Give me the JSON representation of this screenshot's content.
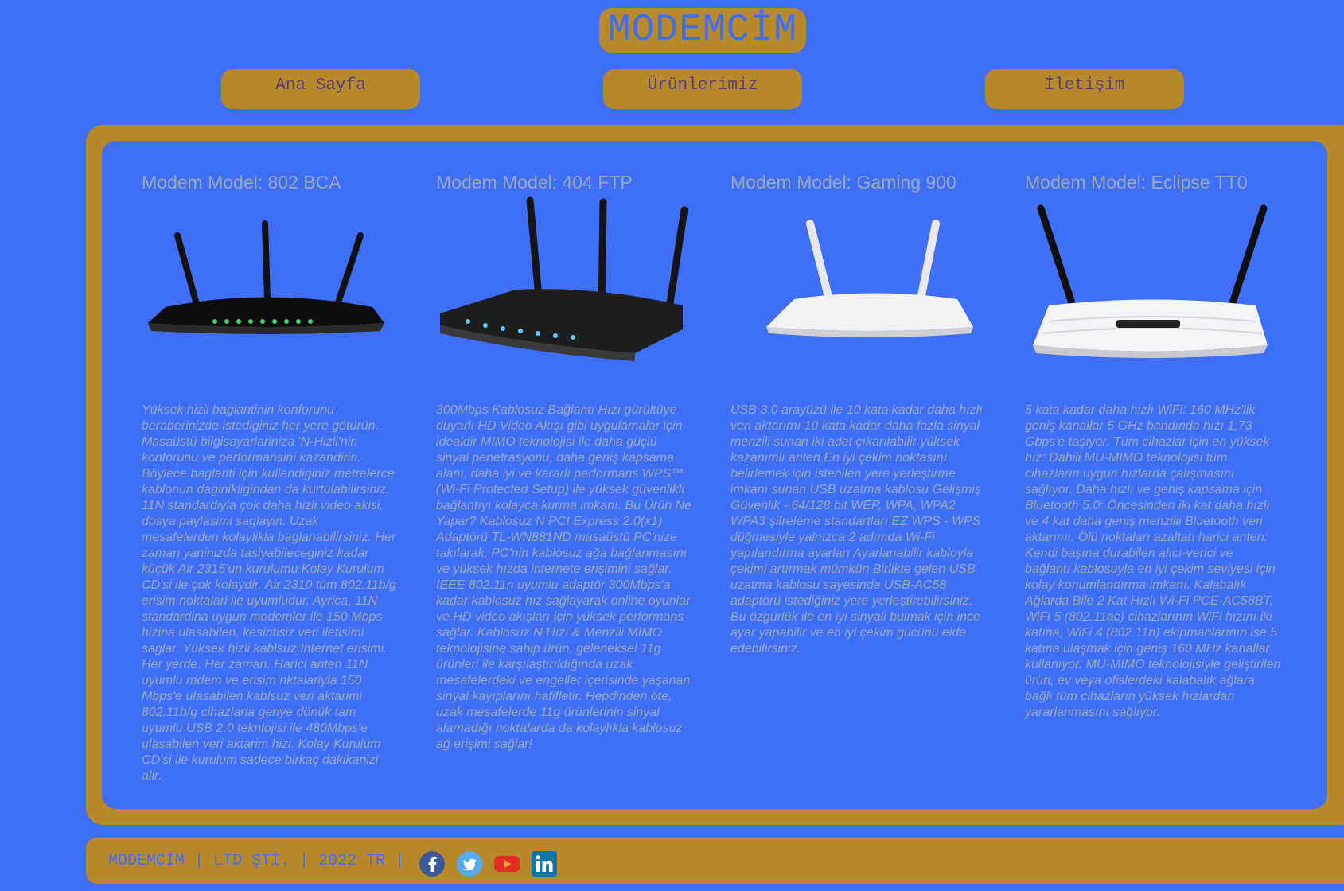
{
  "brand": {
    "logo_text": "MODEMCİM"
  },
  "nav": {
    "items": [
      {
        "label": "Ana Sayfa"
      },
      {
        "label": "Ürünlerimiz"
      },
      {
        "label": "İletişim"
      }
    ]
  },
  "products": [
    {
      "title": "Modem Model: 802 BCA",
      "description": "Yüksek hizli baglantinin konforunu beraberinizde istediginiz her yere götürün. Masaüstü bilgisayarlariniza 'N-Hizli'nin konforunu ve performansini kazandirin. Böylece baglanti için kullandiginiz metrelerce kablonun daginikligindan da kurtulabilirsiniz. 11N standardiyla çok daha hizli video akisi, dosya paylasimi saglayin. Uzak mesafelerden kolaylikla baglanabilirsiniz. Her zaman yaninizda tasiyabileceginiz kadar küçük Air 2315'un kurulumu Kolay Kurulum CD'si ile çok kolaydir. Air 2310 tüm 802.11b/g erisim noktalari ile uyumludur. Ayrica, 11N standardina uygun modemler ile 150 Mbps hizina ulasabilen, kesintisiz veri iletisimi saglar. Yüksek hizli kablsuz Internet erisimi. Her yerde. Her zaman. Harici anten 11N uyumlu mdem ve erisim nktalariyla 150 Mbps'e ulasabilen kablsuz veri aktarimi 802.11b/g cihazlarla geriye dönük tam uyumlu USB 2.0 teknlojisi ile 480Mbps'e ulasabilen veri aktarim hizi. Kolay Kurulum CD'si ile kurulum sadece birkaç dakikanizi alir."
    },
    {
      "title": "Modem Model: 404 FTP",
      "description": "300Mbps Kablosuz Bağlantı Hızı gürültüye duyarlı HD Video Akışı gibi uygulamalar için idealdir MIMO teknolojisi ile daha güçlü sinyal penetrasyonu, daha geniş kapsama alanı, daha iyi ve kararlı performans WPS™ (Wi-Fi Protected Setup) ile yüksek güvenlikli bağlantıyı kolayca kurma imkanı. Bu Ürün Ne Yapar? Kablosuz N PCI Express 2.0(x1) Adaptörü TL-WN881ND masaüstü PC'nize takılarak, PC'nin kablosuz ağa bağlanmasını ve yüksek hızda internete erişimini sağlar. IEEE 802.11n uyumlu adaptör 300Mbps'a kadar kablosuz hız sağlayarak online oyunlar ve HD video akışları için yüksek performans sağlar. Kablosuz N Hızı & Menzili MIMO teknolojisine sahip ürün, geleneksel 11g ürünleri ile karşılaştırıldığında uzak mesafelerdeki ve engeller içerisinde yaşanan sinyal kayıplarını hafifletir. Hepdinden öte, uzak mesafelerde 11g ürünlerinin sinyal alamadığı noktalarda da kolaylıkla kablosuz ağ erişimi sağlar!"
    },
    {
      "title": "Modem Model: Gaming 900",
      "description": "USB 3.0 arayüzü ile 10 kata kadar daha hızlı veri aktarımı 10 kata kadar daha fazla sinyal menzili sunan iki adet çıkarılabilir yüksek kazanımlı anten En iyi çekim noktasını belirlemek için istenilen yere yerleştirme imkanı sunan USB uzatma kablosu Gelişmiş Güvenlik - 64/128 bit WEP, WPA, WPA2 WPA3 şifreleme standartları EZ WPS - WPS düğmesiyle yalnızca 2 adımda Wi-Fi yapılandırma ayarları Ayarlanabilir kabloyla çekimi artırmak mümkün Birlikte gelen USB uzatma kablosu sayesinde USB-AC58 adaptörü istediğiniz yere yerleştirebilirsiniz. Bu özgürlük ile en iyi sinyali bulmak için ince ayar yapabilir ve en iyi çekim gücünü elde edebilirsiniz."
    },
    {
      "title": "Modem Model: Eclipse TT0",
      "description": "5 kata kadar daha hızlı WiFi: 160 MHz'lik geniş kanallar 5 GHz bandında hızı 1,73 Gbps'e taşıyor. Tüm cihazlar için en yüksek hız: Dahili MU-MIMO teknolojisi tüm cihazların uygun hızlarda çalışmasını sağlıyor. Daha hızlı ve geniş kapsama için Bluetooth 5.0: Öncesinden iki kat daha hızlı ve 4 kat daha geniş menzilli Bluetooth veri aktarımı. Ölü noktaları azaltan harici anten: Kendi başına durabilen alıcı-verici ve bağlantı kablosuyla en iyi çekim seviyesi için kolay konumlandırma imkanı. Kalabalık Ağlarda Bile 2 Kat Hızlı Wi-Fi PCE-AC58BT, WiFi 5 (802.11ac) cihazlarının WiFi hızını iki katına, WiFi 4 (802.11n) ekipmanlarının ise 5 katına ulaşmak için geniş 160 MHz kanallar kullanıyor. MU-MIMO teknolojisiyle geliştirilen ürün, ev veya ofislerdeki kalabalık ağlara bağlı tüm cihazların yüksek hızlardan yararlanmasını sağlıyor."
    }
  ],
  "footer": {
    "text": "MODEMCİM | LTD ŞTİ. | 2022 TR |",
    "social": [
      {
        "icon": "facebook-icon"
      },
      {
        "icon": "twitter-icon"
      },
      {
        "icon": "youtube-icon"
      },
      {
        "icon": "linkedin-icon"
      }
    ]
  },
  "colors": {
    "background": "#3f6ff7",
    "accent": "#b8892b",
    "text_muted": "#9aa6bd",
    "nav_text": "#5a3d7a"
  }
}
